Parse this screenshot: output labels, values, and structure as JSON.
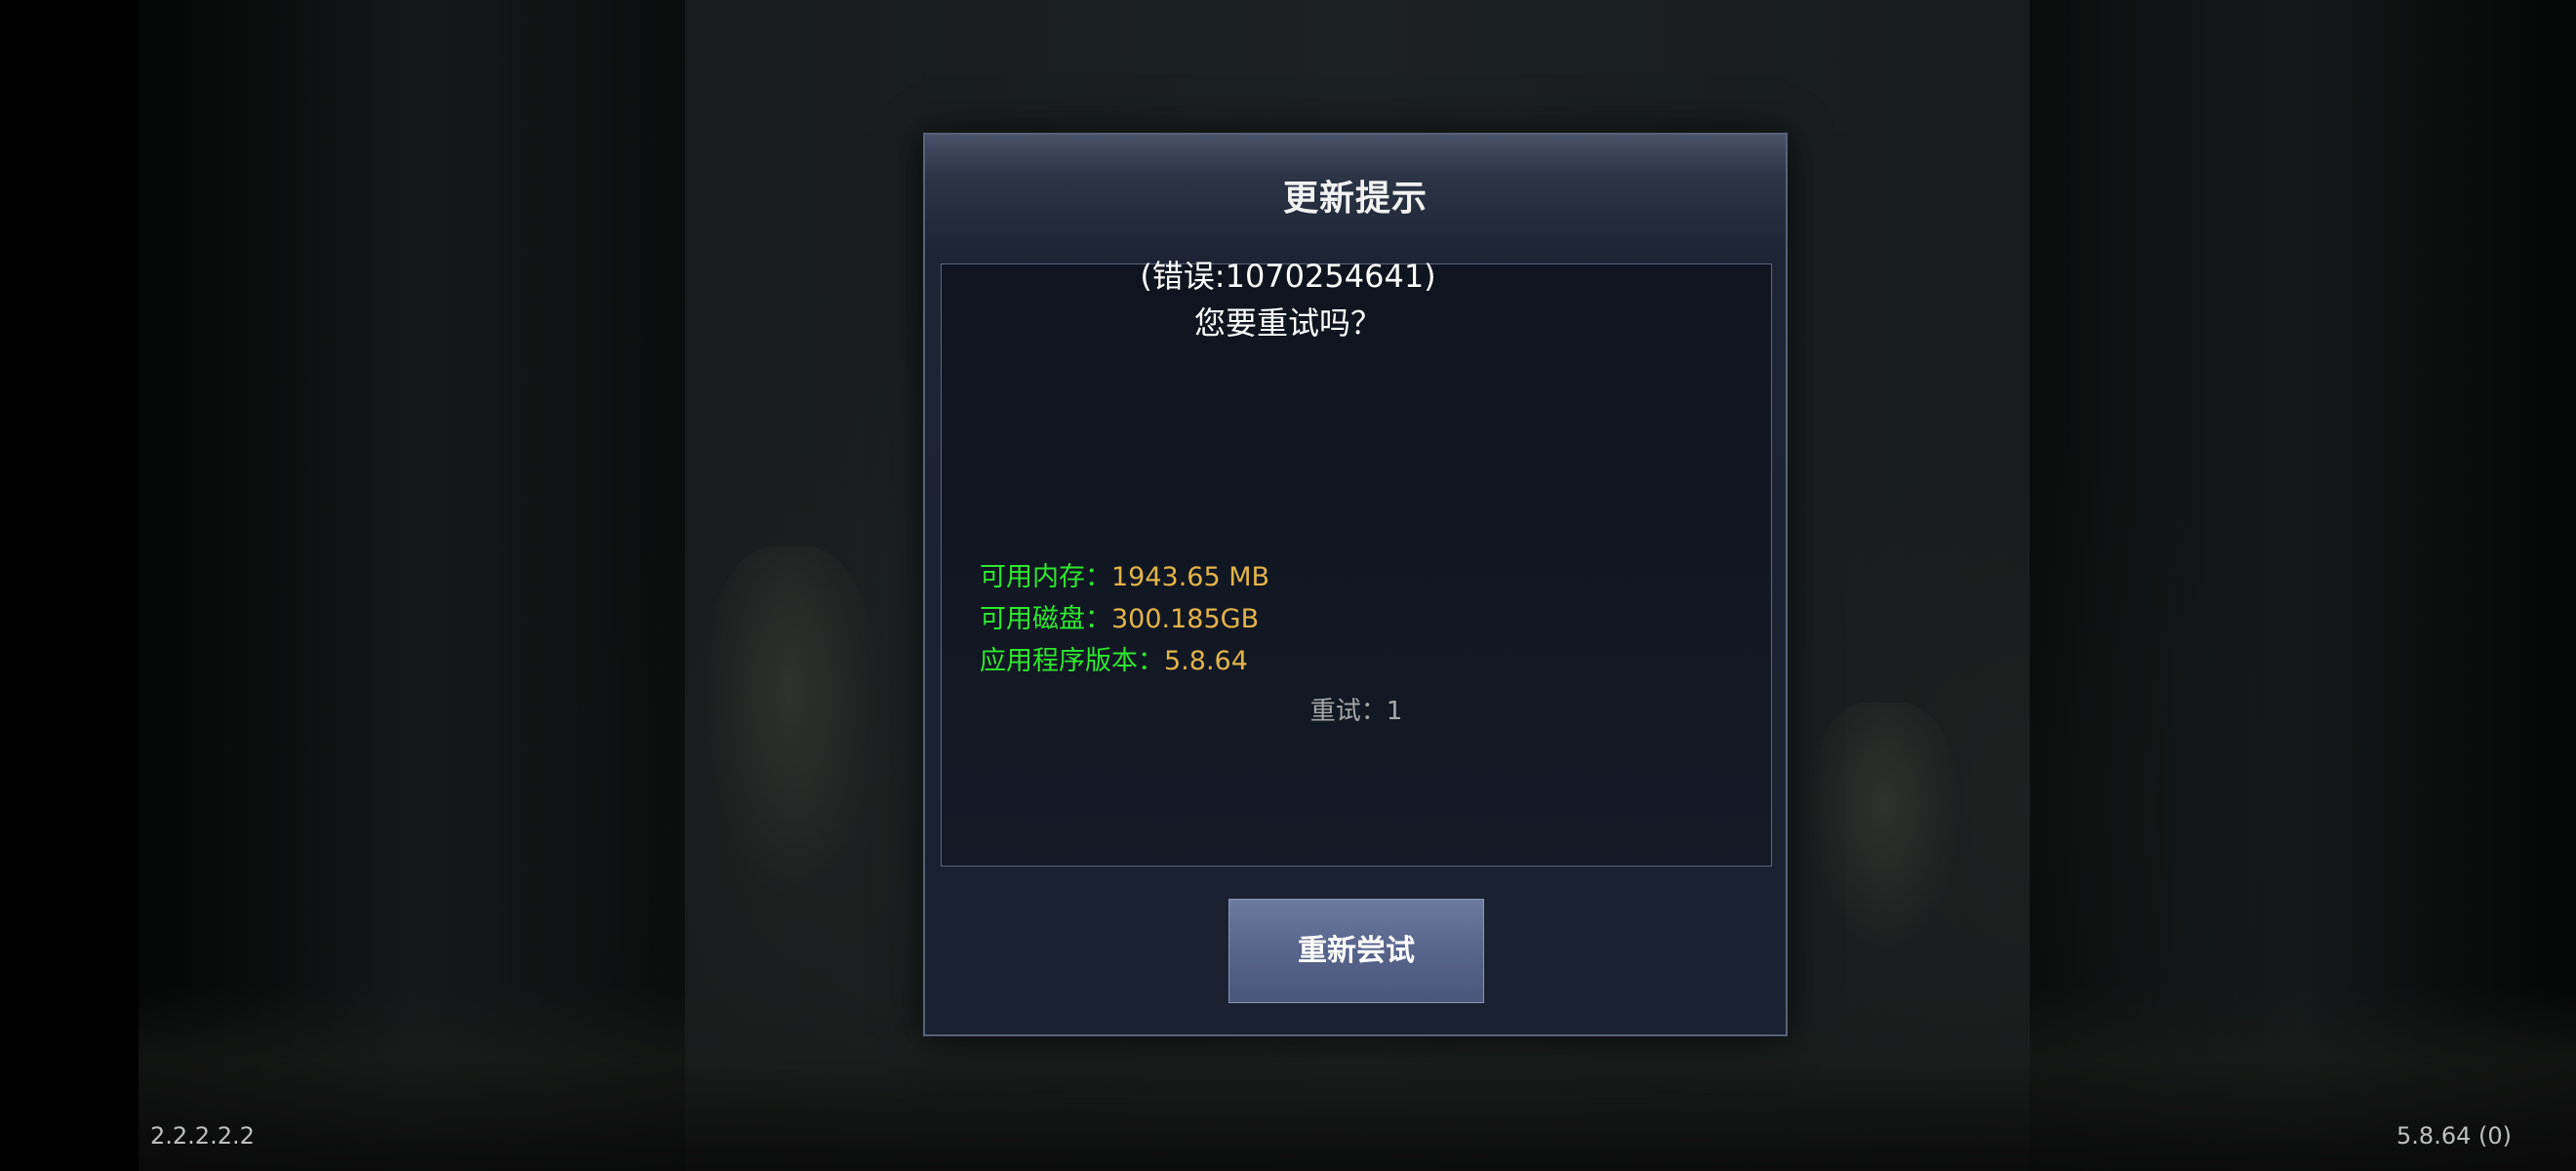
{
  "dialog": {
    "title": "更新提示",
    "error_code_text": "(错误:1070254641)",
    "question_text": "您要重试吗？",
    "retry_button_label": "重新尝试"
  },
  "info": {
    "memory_label": "可用内存：",
    "memory_value": "1943.65 MB",
    "disk_label": "可用磁盘：",
    "disk_value": "300.185GB",
    "app_version_label": "应用程序版本：",
    "app_version_value": "5.8.64",
    "retry_count_text": "重试：1"
  },
  "footer": {
    "left_version": "2.2.2.2.2",
    "right_version": "5.8.64 (0)"
  },
  "colors": {
    "label_green": "#2ee82e",
    "value_gold": "#e3b44a",
    "button_blue": "#58658b",
    "dialog_bg": "#1a2130"
  }
}
